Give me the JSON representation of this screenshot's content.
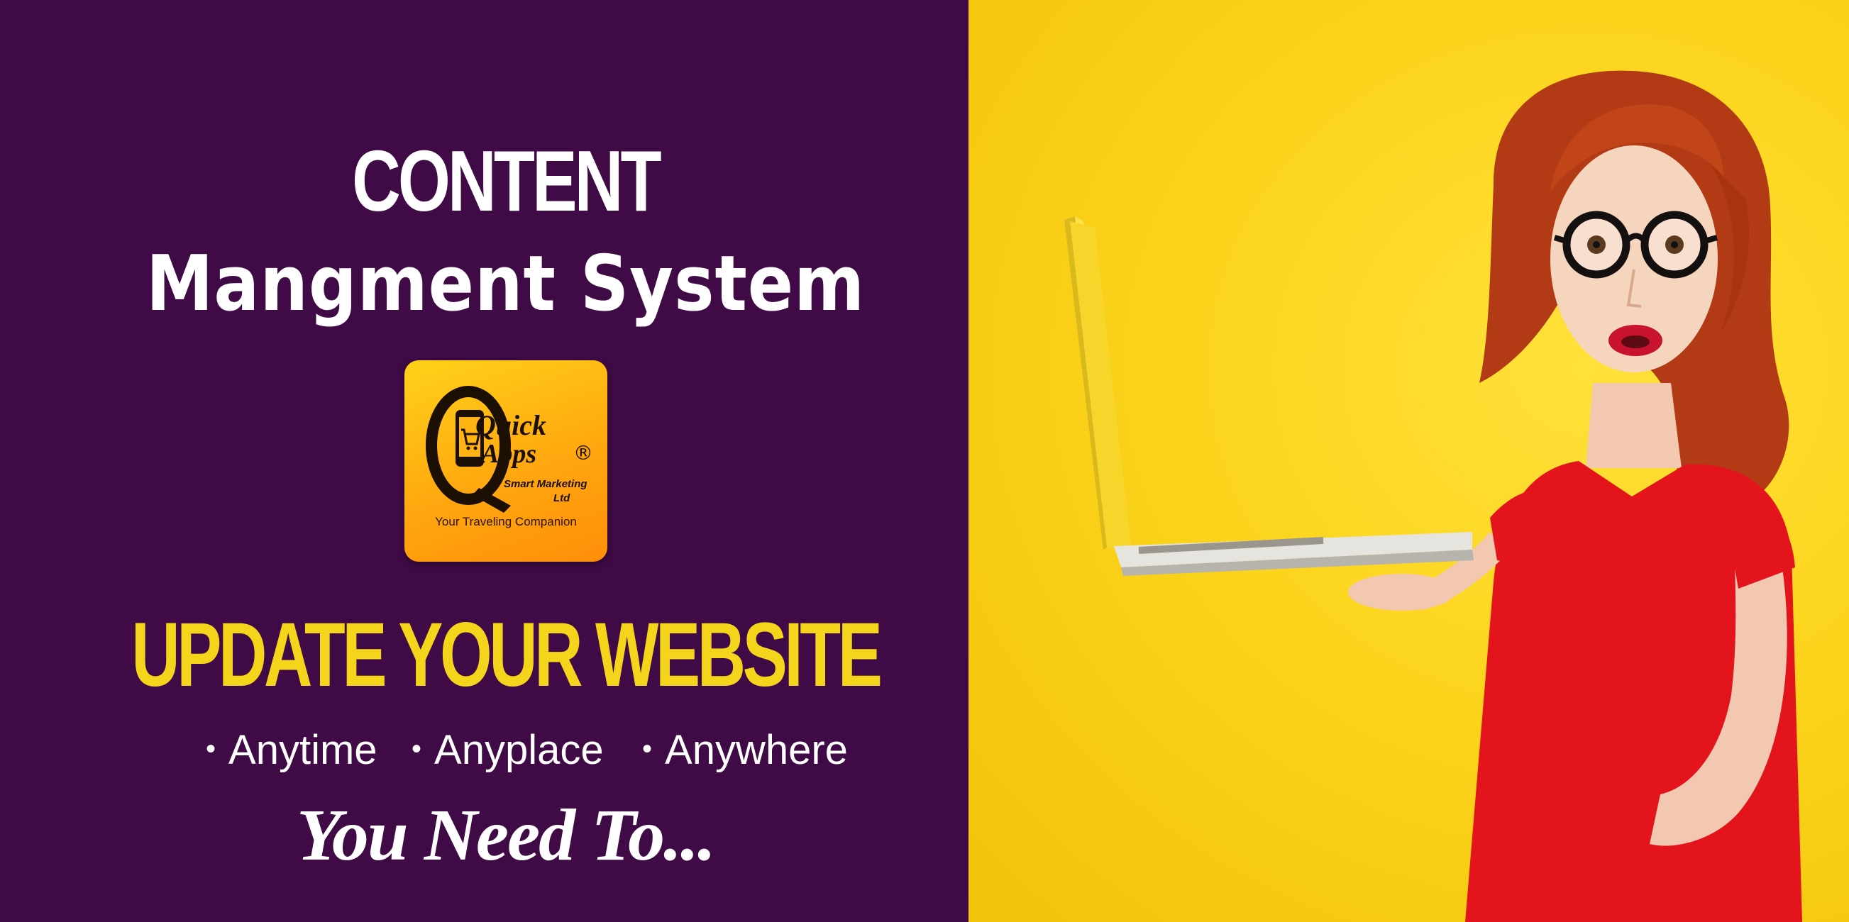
{
  "headline": {
    "line1": "CONTENT",
    "line2": "Mangment System"
  },
  "logo": {
    "quick": "Quick",
    "apps": "Apps",
    "registered": "®",
    "company_line1": "Smart Marketing",
    "company_line2": "Ltd",
    "tagline": "Your Traveling Companion"
  },
  "cta": {
    "title": "UPDATE YOUR WEBSITE",
    "bullets": [
      "Anytime",
      "Anyplace",
      "Anywhere"
    ],
    "closing": "You Need To..."
  },
  "colors": {
    "left_background": "#3f0a45",
    "right_background": "#fcd41c",
    "accent_yellow": "#f4d51c",
    "dress_red": "#e3141c",
    "hair": "#b23a14"
  },
  "image": {
    "subject": "woman-with-laptop-photo"
  }
}
